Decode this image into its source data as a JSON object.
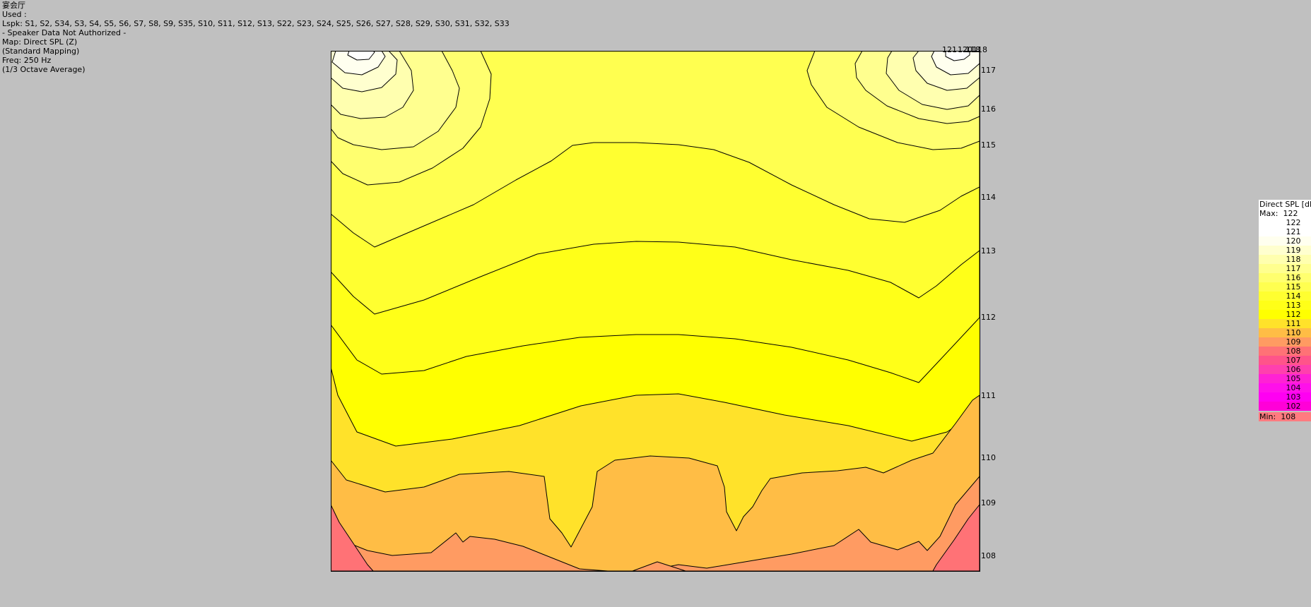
{
  "info": {
    "venue": "宴会厅",
    "used_label": "Used :",
    "loudspeakers": "Lspk: S1, S2, S34, S3, S4, S5, S6, S7, S8, S9, S35, S10, S11, S12, S13, S22, S23, S24, S25, S26, S27, S28, S29, S30, S31, S32, S33",
    "authorization": "- Speaker Data Not Authorized -",
    "map": "Map: Direct SPL (Z)",
    "mapping": "(Standard Mapping)",
    "freq": "Freq: 250 Hz",
    "averaging": "(1/3 Octave Average)"
  },
  "chart_data": {
    "type": "heatmap",
    "title": "",
    "contour_levels": [
      108,
      109,
      110,
      111,
      112,
      113,
      114,
      115,
      116,
      117,
      118,
      119,
      120,
      121
    ],
    "contour_labels_right": [
      "117",
      "116",
      "115",
      "114",
      "113",
      "112",
      "111",
      "110",
      "109",
      "108"
    ],
    "contour_labels_top": [
      "121",
      "120",
      "118",
      "118"
    ],
    "background_level": 112,
    "legend": {
      "title": "Direct SPL [dB]",
      "max_label": "Max:",
      "max_value": "122",
      "min_label": "Min:",
      "min_value": "108",
      "entries": [
        {
          "label": "122",
          "color": "#ffffff"
        },
        {
          "label": "121",
          "color": "#ffffff"
        },
        {
          "label": "120",
          "color": "#ffffef"
        },
        {
          "label": "119",
          "color": "#ffffcf"
        },
        {
          "label": "118",
          "color": "#ffffaf"
        },
        {
          "label": "117",
          "color": "#ffff8f"
        },
        {
          "label": "116",
          "color": "#ffff6f"
        },
        {
          "label": "115",
          "color": "#ffff50"
        },
        {
          "label": "114",
          "color": "#ffff30"
        },
        {
          "label": "113",
          "color": "#ffff18"
        },
        {
          "label": "112",
          "color": "#ffff00"
        },
        {
          "label": "111",
          "color": "#ffe22a"
        },
        {
          "label": "110",
          "color": "#ffbd45"
        },
        {
          "label": "109",
          "color": "#ff9b62"
        },
        {
          "label": "108",
          "color": "#ff7276"
        },
        {
          "label": "107",
          "color": "#ff548a"
        },
        {
          "label": "106",
          "color": "#ff40ae"
        },
        {
          "label": "105",
          "color": "#ff22d4"
        },
        {
          "label": "104",
          "color": "#ff10ea"
        },
        {
          "label": "103",
          "color": "#ff00f2"
        },
        {
          "label": "102",
          "color": "#ff00d8"
        }
      ],
      "min_color": "#ff7b80"
    }
  }
}
